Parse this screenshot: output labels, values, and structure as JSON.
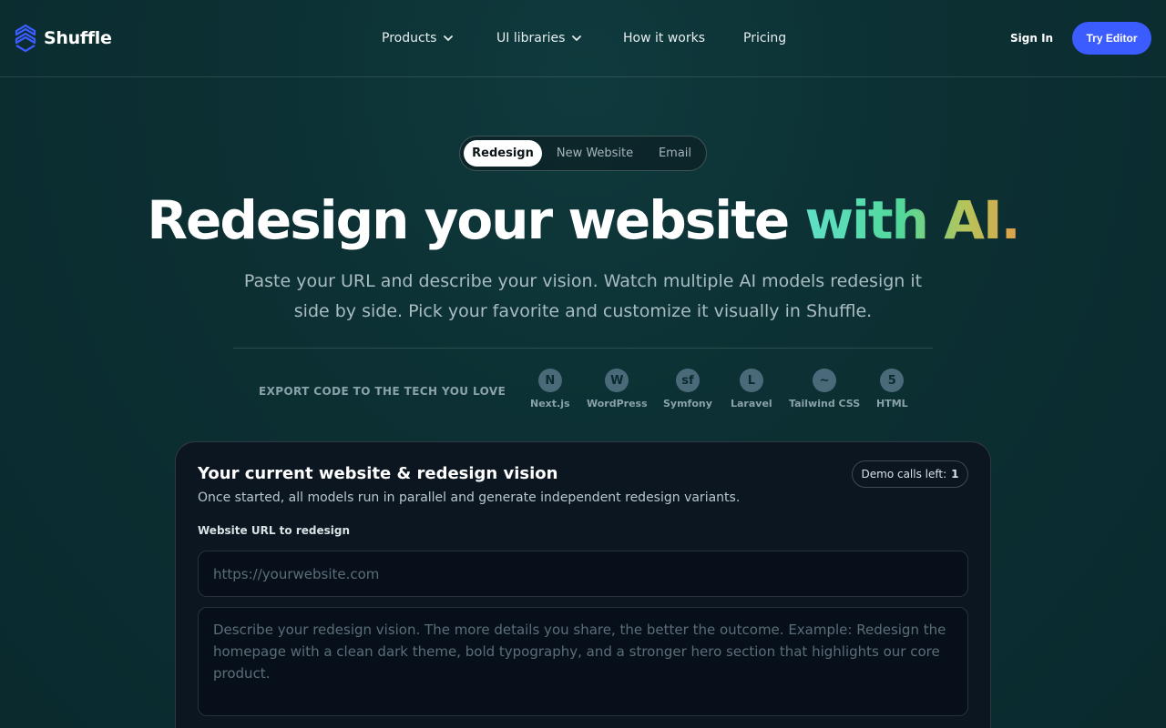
{
  "brand": {
    "name": "Shuffle",
    "accent": "#3b5cff",
    "logo_color": "#3b5cff"
  },
  "nav": {
    "items": [
      {
        "label": "Products",
        "has_dropdown": true
      },
      {
        "label": "UI libraries",
        "has_dropdown": true
      },
      {
        "label": "How it works",
        "has_dropdown": false
      },
      {
        "label": "Pricing",
        "has_dropdown": false
      }
    ],
    "sign_in": "Sign In",
    "try_editor": "Try Editor"
  },
  "mode_tabs": {
    "items": [
      "Redesign",
      "New Website",
      "Email"
    ],
    "selected": "Redesign"
  },
  "hero": {
    "title_main": "Redesign your website ",
    "title_highlight_1": "with",
    "title_highlight_2": " AI",
    "title_dot": ".",
    "subtitle": "Paste your URL and describe your vision. Watch multiple AI models redesign it side by side. Pick your favorite and customize it visually in Shuffle."
  },
  "export": {
    "label": "EXPORT CODE TO THE TECH YOU LOVE",
    "techs": [
      {
        "name": "Next.js",
        "icon": "nextjs-icon",
        "glyph": "N"
      },
      {
        "name": "WordPress",
        "icon": "wordpress-icon",
        "glyph": "W"
      },
      {
        "name": "Symfony",
        "icon": "symfony-icon",
        "glyph": "sf"
      },
      {
        "name": "Laravel",
        "icon": "laravel-icon",
        "glyph": "L"
      },
      {
        "name": "Tailwind CSS",
        "icon": "tailwind-icon",
        "glyph": "~"
      },
      {
        "name": "HTML",
        "icon": "html-icon",
        "glyph": "5"
      }
    ]
  },
  "form": {
    "title": "Your current website & redesign vision",
    "description": "Once started, all models run in parallel and generate independent redesign variants.",
    "demo_calls_label": "Demo calls left:",
    "demo_calls_value": "1",
    "url_label": "Website URL to redesign",
    "url_placeholder": "https://yourwebsite.com",
    "url_value": "",
    "vision_placeholder": "Describe your redesign vision. The more details you share, the better the outcome. Example: Redesign the homepage with a clean dark theme, bold typography, and a stronger hero section that highlights our core product.",
    "vision_value": ""
  }
}
